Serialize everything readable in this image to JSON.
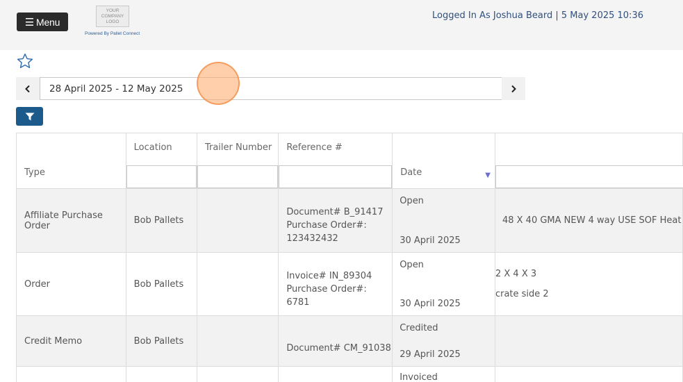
{
  "header": {
    "menu_label": "Menu",
    "logo_lines": [
      "YOUR",
      "COMPANY",
      "LOGO"
    ],
    "powered_by": "Powered By Pallet Connect",
    "login_text": "Logged In As Joshua Beard | 5 May 2025 10:36"
  },
  "toolbar": {
    "favorite_icon": "star-outline-icon",
    "date_range": "28 April 2025 - 12 May 2025",
    "prev_label": "‹",
    "next_label": "›",
    "filter_icon": "funnel-icon",
    "accent_color": "#1d5a8c"
  },
  "table": {
    "columns": {
      "type": "Type",
      "location": "Location",
      "trailer": "Trailer Number",
      "reference": "Reference #",
      "date": "Date"
    },
    "rows": [
      {
        "type": "Affiliate Purchase Order",
        "location": "Bob Pallets",
        "trailer": "",
        "ref_lines": [
          "Document# B_91417",
          "Purchase Order#:",
          "123432432"
        ],
        "status": "Open",
        "date": "30 April 2025",
        "desc_lines": [
          "48 X 40 GMA NEW 4 way USE SOF Heat"
        ]
      },
      {
        "type": "Order",
        "location": "Bob Pallets",
        "trailer": "",
        "ref_lines": [
          "Invoice# IN_89304",
          "Purchase Order#:",
          "6781"
        ],
        "status": "Open",
        "date": "30 April 2025",
        "desc_lines": [
          "2 X 4 X 3",
          "crate side 2"
        ]
      },
      {
        "type": "Credit Memo",
        "location": "Bob Pallets",
        "trailer": "",
        "ref_lines": [
          "Document# CM_91038"
        ],
        "status": "Credited",
        "date": "29 April 2025",
        "desc_lines": []
      },
      {
        "type": "",
        "location": "",
        "trailer": "",
        "ref_lines": [],
        "status": "Invoiced",
        "date": "",
        "desc_lines": []
      }
    ]
  }
}
